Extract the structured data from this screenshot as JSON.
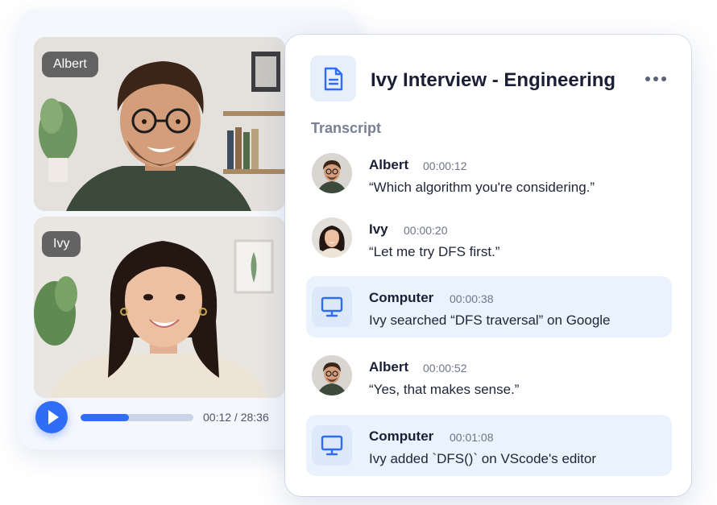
{
  "video": {
    "participants": [
      {
        "name": "Albert"
      },
      {
        "name": "Ivy"
      }
    ],
    "player": {
      "current_time": "00:12",
      "total_time": "28:36",
      "time_label": "00:12 / 28:36",
      "progress": 0.43
    }
  },
  "transcript": {
    "title": "Ivy Interview - Engineering",
    "section_label": "Transcript",
    "entries": [
      {
        "speaker": "Albert",
        "time": "00:00:12",
        "text": "“Which algorithm you're considering.”",
        "type": "person"
      },
      {
        "speaker": "Ivy",
        "time": "00:00:20",
        "text": "“Let me try DFS first.”",
        "type": "person"
      },
      {
        "speaker": "Computer",
        "time": "00:00:38",
        "text": "Ivy searched “DFS traversal” on Google",
        "type": "computer"
      },
      {
        "speaker": "Albert",
        "time": "00:00:52",
        "text": "“Yes, that makes sense.”",
        "type": "person"
      },
      {
        "speaker": "Computer",
        "time": "00:01:08",
        "text": "Ivy added `DFS()` on VScode's editor",
        "type": "computer"
      }
    ]
  },
  "icons": {
    "doc": "document-icon",
    "more": "more-options-icon",
    "play": "play-icon",
    "computer": "monitor-icon"
  },
  "colors": {
    "accent": "#2f6df6",
    "computer_row_bg": "#eaf2fd",
    "title_text": "#1a1f36"
  }
}
